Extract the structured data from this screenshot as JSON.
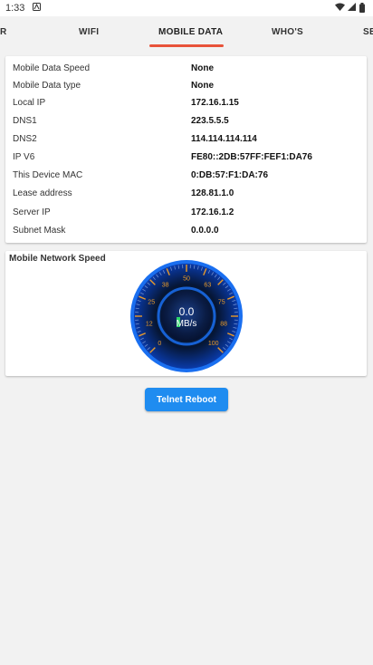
{
  "status_bar": {
    "time": "1:33",
    "icons": [
      "notification-icon",
      "wifi-icon",
      "signal-icon",
      "battery-icon"
    ]
  },
  "tabs": [
    {
      "label": "R",
      "active": false
    },
    {
      "label": "WIFI",
      "active": false
    },
    {
      "label": "MOBILE DATA",
      "active": true
    },
    {
      "label": "WHO'S",
      "active": false
    },
    {
      "label": "SE",
      "active": false
    }
  ],
  "colors": {
    "accent": "#e8533a",
    "button": "#1f8cf0",
    "gauge_ring": "#1a6ff0",
    "gauge_tick": "#e89a2a"
  },
  "info": [
    {
      "label": "Mobile Data Speed",
      "value": "None"
    },
    {
      "label": "Mobile Data type",
      "value": "None"
    },
    {
      "label": "Local IP",
      "value": "172.16.1.15"
    },
    {
      "label": "DNS1",
      "value": "223.5.5.5"
    },
    {
      "label": "DNS2",
      "value": "114.114.114.114"
    },
    {
      "label": "IP V6",
      "value": "FE80::2DB:57FF:FEF1:DA76"
    },
    {
      "label": "This Device MAC",
      "value": "0:DB:57:F1:DA:76"
    },
    {
      "label": "Lease address",
      "value": "128.81.1.0"
    },
    {
      "label": "Server IP",
      "value": "172.16.1.2"
    },
    {
      "label": "Subnet Mask",
      "value": "0.0.0.0"
    }
  ],
  "speed": {
    "title": "Mobile Network Speed",
    "value": "0.0",
    "unit": "MB/s",
    "scale_labels": [
      "0",
      "12",
      "25",
      "38",
      "50",
      "63",
      "75",
      "88",
      "100"
    ]
  },
  "actions": {
    "reboot_label": "Telnet Reboot"
  }
}
